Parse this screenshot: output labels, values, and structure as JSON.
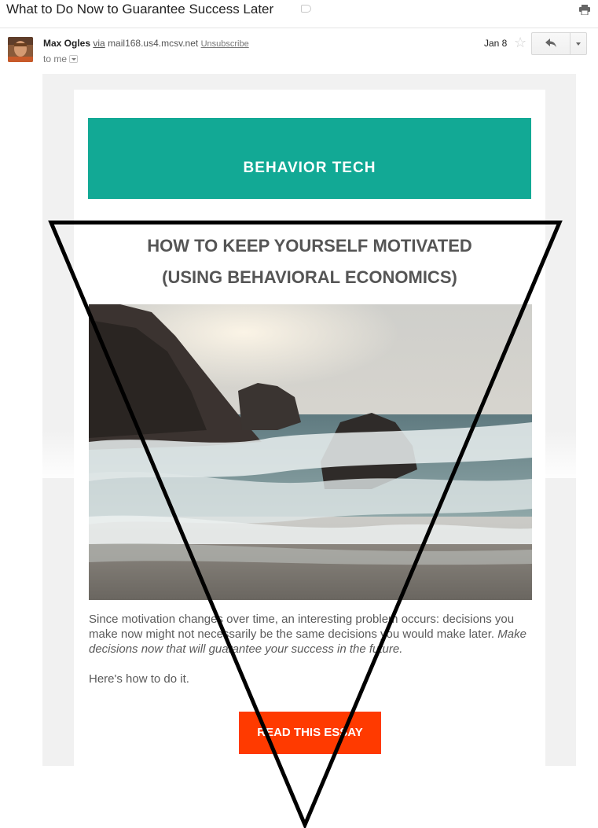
{
  "message": {
    "subject": "What to Do Now to Guarantee Success Later",
    "sender_name": "Max Ogles",
    "via_label": "via",
    "via_domain": "mail168.us4.mcsv.net",
    "unsubscribe_label": "Unsubscribe",
    "to_label": "to me",
    "date": "Jan 8"
  },
  "icons": {
    "label": "label-icon",
    "print": "print-icon",
    "star": "star-icon",
    "reply": "reply-arrow-icon",
    "more": "chevron-down-icon",
    "to_details": "chevron-down-icon"
  },
  "email": {
    "brand": "BEHAVIOR TECH",
    "headline_line1": "HOW TO KEEP YOURSELF MOTIVATED",
    "headline_line2": "(USING BEHAVIORAL ECONOMICS)",
    "hero_image": "beach-rocks-waves-photo",
    "paragraph_part1": "Since motivation changes over time, an interesting problem occurs: decisions you make now might not necessarily be the same decisions you would make later. ",
    "paragraph_emphasis": "Make decisions now that will guarantee your success in the future.",
    "paragraph2": "Here's how to do it.",
    "cta_label": "READ THIS ESSAY"
  },
  "colors": {
    "brand_teal": "#12a995",
    "cta_orange": "#ff3a00",
    "overlay_triangle": "#000000"
  }
}
